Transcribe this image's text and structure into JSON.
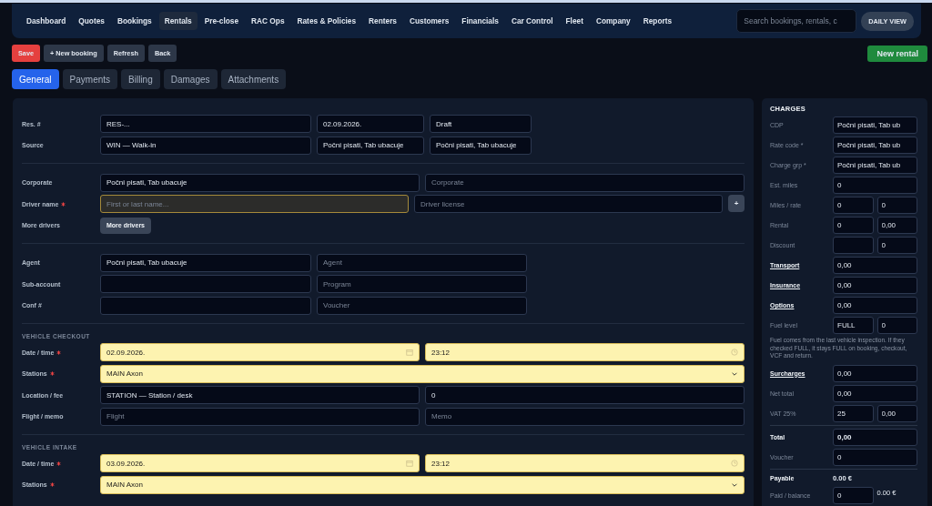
{
  "nav": {
    "items": [
      {
        "label": "Dashboard",
        "selected": false
      },
      {
        "label": "Quotes",
        "selected": false
      },
      {
        "label": "Bookings",
        "selected": false
      },
      {
        "label": "Rentals",
        "selected": true
      },
      {
        "label": "Pre-close",
        "selected": false
      },
      {
        "label": "RAC Ops",
        "selected": false
      },
      {
        "label": "Rates & Policies",
        "selected": false
      },
      {
        "label": "Renters",
        "selected": false
      },
      {
        "label": "Customers",
        "selected": false
      },
      {
        "label": "Financials",
        "selected": false
      },
      {
        "label": "Car Control",
        "selected": false
      },
      {
        "label": "Fleet",
        "selected": false
      },
      {
        "label": "Company",
        "selected": false
      },
      {
        "label": "Reports",
        "selected": false
      }
    ],
    "search": {
      "placeholder": "Search bookings, rentals, c"
    },
    "view_button": "DAILY VIEW"
  },
  "actions": [
    {
      "label": "Save",
      "kind": "danger"
    },
    {
      "label": "+ New booking",
      "kind": "default"
    },
    {
      "label": "Refresh",
      "kind": "default"
    },
    {
      "label": "Back",
      "kind": "default"
    }
  ],
  "primary_action": {
    "label": "New rental",
    "kind": "success"
  },
  "tabs": [
    {
      "label": "General",
      "selected": true
    },
    {
      "label": "Payments",
      "selected": false
    },
    {
      "label": "Billing",
      "selected": false
    },
    {
      "label": "Damages",
      "selected": false
    },
    {
      "label": "Attachments",
      "selected": false
    }
  ],
  "sections": [
    {
      "rows": [
        {
          "label": "Res. #",
          "required": false,
          "kind": "triple",
          "fields": [
            {
              "kind": "text",
              "value": "RES-..."
            },
            {
              "kind": "text",
              "value": "02.09.2026."
            },
            {
              "kind": "text",
              "value": "Draft"
            }
          ]
        },
        {
          "label": "Source",
          "required": false,
          "kind": "triple",
          "fields": [
            {
              "kind": "text",
              "value": "WIN — Walk-in"
            },
            {
              "kind": "text",
              "value": "Počni pisati, Tab ubacuje"
            },
            {
              "kind": "text",
              "value": "Počni pisati, Tab ubacuje"
            }
          ]
        }
      ]
    },
    {
      "rows": [
        {
          "label": "Corporate",
          "required": false,
          "kind": "split",
          "fields": [
            {
              "kind": "text",
              "value": "Počni pisati, Tab ubacuje"
            },
            {
              "kind": "text",
              "placeholder": "Corporate"
            }
          ]
        },
        {
          "label": "Driver name",
          "required": true,
          "kind": "split-add",
          "fields": [
            {
              "kind": "focus",
              "placeholder": "First or last name..."
            },
            {
              "kind": "text",
              "placeholder": "Driver license"
            },
            {
              "kind": "add",
              "value": "+"
            }
          ]
        },
        {
          "label": "More drivers",
          "required": false,
          "kind": "action",
          "fields": [
            {
              "kind": "button",
              "value": "More drivers"
            }
          ]
        }
      ]
    },
    {
      "rows": [
        {
          "label": "Agent",
          "required": false,
          "kind": "pair",
          "fields": [
            {
              "kind": "text",
              "value": "Počni pisati, Tab ubacuje"
            },
            {
              "kind": "text",
              "placeholder": "Agent"
            }
          ]
        },
        {
          "label": "Sub-account",
          "required": false,
          "kind": "pair",
          "fields": [
            {
              "kind": "text"
            },
            {
              "kind": "text",
              "placeholder": "Program"
            }
          ]
        },
        {
          "label": "Conf #",
          "required": false,
          "kind": "pair",
          "fields": [
            {
              "kind": "text"
            },
            {
              "kind": "text",
              "placeholder": "Voucher"
            }
          ]
        }
      ]
    },
    {
      "title": "VEHICLE CHECKOUT",
      "rows": [
        {
          "label": "Date / time",
          "required": true,
          "kind": "split",
          "fields": [
            {
              "kind": "date",
              "value": "02.09.2026."
            },
            {
              "kind": "time",
              "value": "23:12"
            }
          ]
        },
        {
          "label": "Stations",
          "required": true,
          "kind": "full",
          "fields": [
            {
              "kind": "select",
              "value": "MAIN Axon"
            }
          ]
        },
        {
          "label": "Location / fee",
          "required": false,
          "kind": "split",
          "fields": [
            {
              "kind": "text",
              "value": "STATION — Station / desk"
            },
            {
              "kind": "text",
              "value": "0"
            }
          ]
        },
        {
          "label": "Flight / memo",
          "required": false,
          "kind": "split",
          "fields": [
            {
              "kind": "text",
              "placeholder": "Flight"
            },
            {
              "kind": "text",
              "placeholder": "Memo"
            }
          ]
        }
      ]
    },
    {
      "title": "VEHICLE INTAKE",
      "rows": [
        {
          "label": "Date / time",
          "required": true,
          "kind": "split",
          "fields": [
            {
              "kind": "date",
              "value": "03.09.2026."
            },
            {
              "kind": "time",
              "value": "23:12"
            }
          ]
        },
        {
          "label": "Stations",
          "required": true,
          "kind": "full",
          "fields": [
            {
              "kind": "select",
              "value": "MAIN Axon"
            }
          ]
        }
      ]
    }
  ],
  "charges": {
    "title": "CHARGES",
    "items": [
      {
        "kind": "plain",
        "label": "CDP",
        "fields": [
          {
            "kind": "input",
            "value": "Počni pisati, Tab ub"
          }
        ]
      },
      {
        "kind": "plain",
        "label": "Rate code *",
        "fields": [
          {
            "kind": "input",
            "value": "Počni pisati, Tab ub"
          }
        ]
      },
      {
        "kind": "plain",
        "label": "Charge grp *",
        "fields": [
          {
            "kind": "input",
            "value": "Počni pisati, Tab ub"
          }
        ]
      },
      {
        "kind": "plain",
        "label": "Est. miles",
        "fields": [
          {
            "kind": "input",
            "value": "0"
          }
        ]
      },
      {
        "kind": "plain",
        "label": "Miles / rate",
        "fields": [
          {
            "kind": "input",
            "value": "0"
          },
          {
            "kind": "input",
            "value": "0"
          }
        ]
      },
      {
        "kind": "plain",
        "label": "Rental",
        "fields": [
          {
            "kind": "input",
            "value": "0"
          },
          {
            "kind": "input",
            "value": "0,00"
          }
        ]
      },
      {
        "kind": "plain",
        "label": "Discount",
        "fields": [
          {
            "kind": "input"
          },
          {
            "kind": "input",
            "value": "0"
          }
        ]
      },
      {
        "kind": "link",
        "label": "Transport",
        "fields": [
          {
            "kind": "input",
            "value": "0,00"
          }
        ]
      },
      {
        "kind": "link",
        "label": "Insurance",
        "fields": [
          {
            "kind": "input",
            "value": "0,00"
          }
        ]
      },
      {
        "kind": "link",
        "label": "Options",
        "fields": [
          {
            "kind": "input",
            "value": "0,00"
          }
        ]
      },
      {
        "kind": "plain",
        "label": "Fuel level",
        "fields": [
          {
            "kind": "input",
            "value": "FULL"
          },
          {
            "kind": "input",
            "value": "0"
          }
        ]
      },
      {
        "kind": "note",
        "text": "Fuel comes from the last vehicle inspection. If they checked FULL, it stays FULL on booking, checkout, VCF and return."
      },
      {
        "kind": "link",
        "label": "Surcharges",
        "fields": [
          {
            "kind": "input",
            "value": "0,00"
          }
        ]
      },
      {
        "kind": "plain",
        "label": "Net total",
        "fields": [
          {
            "kind": "input",
            "value": "0,00"
          }
        ]
      },
      {
        "kind": "plain",
        "label": "VAT 25%",
        "fields": [
          {
            "kind": "input",
            "value": "25"
          },
          {
            "kind": "input",
            "value": "0,00"
          }
        ]
      },
      {
        "kind": "strong",
        "label": "Total",
        "fields": [
          {
            "kind": "input",
            "value": "0,00"
          }
        ]
      },
      {
        "kind": "plain",
        "label": "Voucher",
        "fields": [
          {
            "kind": "input",
            "value": "0"
          }
        ]
      },
      {
        "kind": "strong",
        "label": "Payable",
        "fields": [
          {
            "kind": "text",
            "value": "0.00 €"
          }
        ]
      },
      {
        "kind": "plain",
        "label": "Paid / balance",
        "fields": [
          {
            "kind": "input",
            "value": "0"
          },
          {
            "kind": "text",
            "value": "0.00 €"
          }
        ]
      }
    ]
  }
}
